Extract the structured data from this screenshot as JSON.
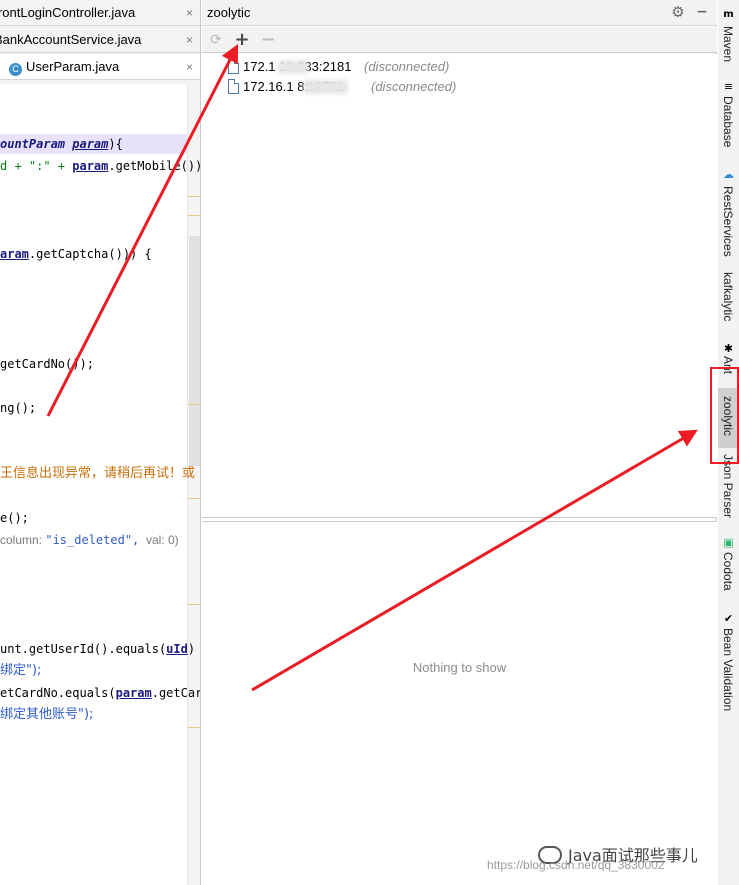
{
  "editor": {
    "tabs": [
      {
        "label": "FrontLoginController.java",
        "close": "×"
      },
      {
        "label": "BankAccountService.java",
        "close": "×"
      },
      {
        "label": "UserParam.java",
        "close": "×",
        "icon": "C"
      }
    ],
    "code_lines": [
      {
        "a": "ountParam ",
        "b": "param",
        "c": "){"
      },
      {
        "a": "d + \":\" + ",
        "b": "param",
        "c": ".getMobile());"
      },
      {
        "a": "aram",
        "b": ".getCaptcha())) {"
      },
      {
        "a": "getCardNo());"
      },
      {
        "a": "ng();"
      },
      {
        "a": "王信息出现异常，请稍后再试！或"
      },
      {
        "a": "e();"
      },
      {
        "a": "column: ",
        "b": "\"is_deleted\",",
        "c": "  val: 0)"
      },
      {
        "a": "unt.getUserId().equals(",
        "b": "uId",
        "c": ")"
      },
      {
        "a": "绑定\");"
      },
      {
        "a": "etCardNo.equals(",
        "b": "param",
        "c": ".getCardI"
      },
      {
        "a": "绑定其他账号\");"
      }
    ]
  },
  "panel": {
    "title": "zoolytic",
    "gear_icon": "⚙",
    "minimize_icon": "−",
    "toolbar": {
      "refresh_icon": "⟳",
      "add_icon": "+",
      "remove_icon": "−"
    },
    "nodes": [
      {
        "host": "172.1     19.233:2181",
        "status": "(disconnected)"
      },
      {
        "host": "172.16.1       8:18731",
        "status": "(disconnected)"
      }
    ],
    "empty_text": "Nothing to show"
  },
  "right_toolbar": [
    {
      "label": "Maven",
      "icon": "m"
    },
    {
      "label": "Database",
      "icon": "≡"
    },
    {
      "label": "RestServices",
      "icon": "☁"
    },
    {
      "label": "kafkalytic",
      "icon": ""
    },
    {
      "label": "Ant",
      "icon": "✱"
    },
    {
      "label": "zoolytic",
      "icon": ""
    },
    {
      "label": "Json Parser",
      "icon": ""
    },
    {
      "label": "Codota",
      "icon": "▣"
    },
    {
      "label": "Bean Validation",
      "icon": "✔"
    }
  ],
  "watermark": "https://blog.csdn.net/qq_3830002",
  "brand": "Java面试那些事儿",
  "colors": {
    "annotation_red": "#ec1c24",
    "selection": "#e9e2fb"
  }
}
